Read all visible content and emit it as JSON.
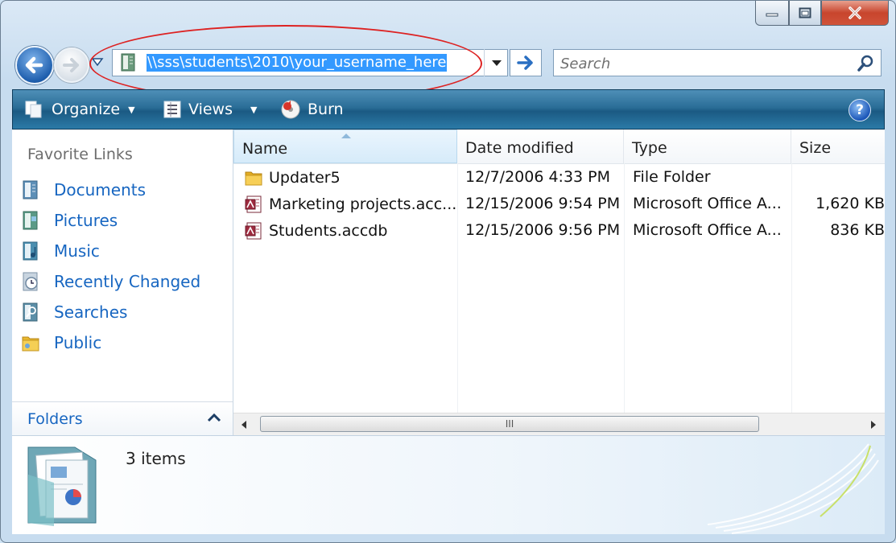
{
  "window": {
    "caption_buttons": [
      "minimize",
      "maximize",
      "close"
    ]
  },
  "address": {
    "path": "\\\\sss\\students\\2010\\your_username_here"
  },
  "search": {
    "placeholder": "Search"
  },
  "toolbar": {
    "organize_label": "Organize",
    "views_label": "Views",
    "burn_label": "Burn"
  },
  "nav_pane": {
    "title": "Favorite Links",
    "links": [
      {
        "label": "Documents",
        "icon": "documents-icon"
      },
      {
        "label": "Pictures",
        "icon": "pictures-icon"
      },
      {
        "label": "Music",
        "icon": "music-icon"
      },
      {
        "label": "Recently Changed",
        "icon": "recently-changed-icon"
      },
      {
        "label": "Searches",
        "icon": "searches-icon"
      },
      {
        "label": "Public",
        "icon": "public-folder-icon"
      }
    ],
    "folders_label": "Folders"
  },
  "file_list": {
    "columns": [
      "Name",
      "Date modified",
      "Type",
      "Size"
    ],
    "rows": [
      {
        "name": "Updater5",
        "date": "12/7/2006 4:33 PM",
        "type": "File Folder",
        "size": "",
        "icon": "folder-icon"
      },
      {
        "name": "Marketing projects.acc...",
        "date": "12/15/2006 9:54 PM",
        "type": "Microsoft Office A...",
        "size": "1,620 KB",
        "icon": "access-db-icon"
      },
      {
        "name": "Students.accdb",
        "date": "12/15/2006 9:56 PM",
        "type": "Microsoft Office A...",
        "size": "836 KB",
        "icon": "access-db-icon"
      }
    ],
    "scrollbar_grip": "III"
  },
  "details_pane": {
    "item_count": "3 items"
  },
  "colors": {
    "toolbar_blue": "#2a6d97",
    "link_blue": "#1766c1",
    "selection_blue": "#3399ff",
    "highlight_ellipse": "#dd2222"
  }
}
